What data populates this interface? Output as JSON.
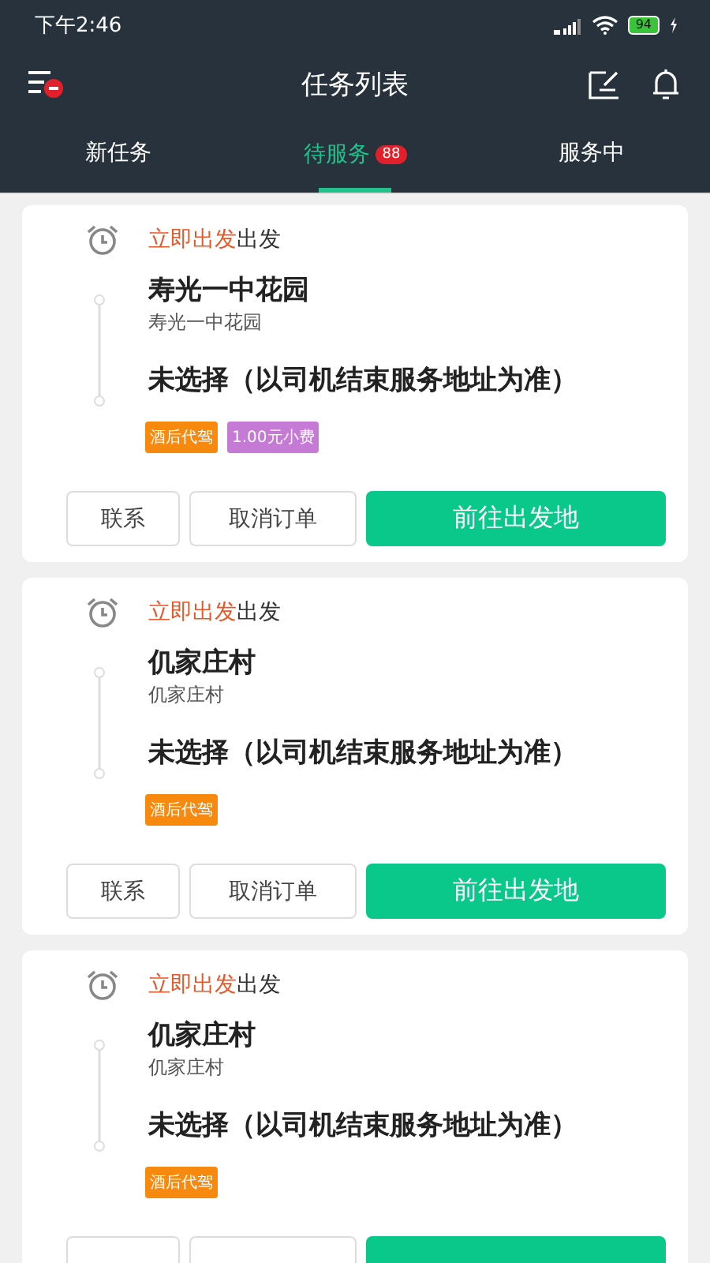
{
  "status_bar": {
    "time": "下午2:46",
    "battery": "94"
  },
  "header": {
    "title": "任务列表"
  },
  "tabs": [
    {
      "label": "新任务",
      "selected": false
    },
    {
      "label": "待服务",
      "selected": true,
      "badge": "88"
    },
    {
      "label": "服务中",
      "selected": false
    }
  ],
  "orders": [
    {
      "time_highlight": "立即出发",
      "time_suffix": "出发",
      "origin": "寿光一中花园",
      "origin_detail": "寿光一中花园",
      "destination": "未选择（以司机结束服务地址为准）",
      "tags": [
        {
          "text": "酒后代驾",
          "color": "#f7890f"
        },
        {
          "text": "1.00元小费",
          "color": "#c57ad6"
        }
      ],
      "buttons": [
        {
          "label": "联系",
          "kind": "plain"
        },
        {
          "label": "取消订单",
          "kind": "plain"
        },
        {
          "label": "前往出发地",
          "kind": "primary"
        }
      ]
    },
    {
      "time_highlight": "立即出发",
      "time_suffix": "出发",
      "origin": "仉家庄村",
      "origin_detail": "仉家庄村",
      "destination": "未选择（以司机结束服务地址为准）",
      "tags": [
        {
          "text": "酒后代驾",
          "color": "#f7890f"
        }
      ],
      "buttons": [
        {
          "label": "联系",
          "kind": "plain"
        },
        {
          "label": "取消订单",
          "kind": "plain"
        },
        {
          "label": "前往出发地",
          "kind": "primary"
        }
      ]
    },
    {
      "time_highlight": "立即出发",
      "time_suffix": "出发",
      "origin": "仉家庄村",
      "origin_detail": "仉家庄村",
      "destination": "未选择（以司机结束服务地址为准）",
      "tags": [
        {
          "text": "酒后代驾",
          "color": "#f7890f"
        }
      ],
      "buttons": [
        {
          "kind": "plain"
        },
        {
          "kind": "plain"
        },
        {
          "kind": "primary"
        }
      ]
    }
  ]
}
